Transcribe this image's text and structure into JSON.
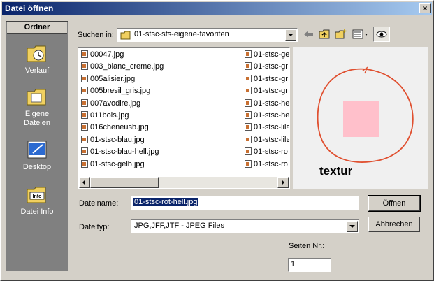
{
  "window": {
    "title": "Datei öffnen",
    "close_label": "×"
  },
  "sidebar": {
    "header": "Ordner",
    "items": [
      {
        "label": "Verlauf",
        "icon": "history-folder-icon"
      },
      {
        "label": "Eigene Dateien",
        "icon": "documents-folder-icon"
      },
      {
        "label": "Desktop",
        "icon": "desktop-icon"
      },
      {
        "label": "Datei Info",
        "icon": "file-info-icon"
      }
    ]
  },
  "lookin": {
    "label": "Suchen in:",
    "value": "01-stsc-sfs-eigene-favoriten"
  },
  "toolbar": {
    "icons": [
      "back-arrow-icon",
      "up-folder-icon",
      "new-folder-icon",
      "view-menu-icon",
      "preview-eye-icon"
    ]
  },
  "files": {
    "col1": [
      "00047.jpg",
      "003_blanc_creme.jpg",
      "005alisier.jpg",
      "005bresil_gris.jpg",
      "007avodire.jpg",
      "011bois.jpg",
      "016cheneusb.jpg",
      "01-stsc-blau.jpg",
      "01-stsc-blau-hell.jpg",
      "01-stsc-gelb.jpg"
    ],
    "col2": [
      "01-stsc-ge",
      "01-stsc-gr",
      "01-stsc-gr",
      "01-stsc-gr",
      "01-stsc-he",
      "01-stsc-he",
      "01-stsc-lila",
      "01-stsc-lila",
      "01-stsc-ro",
      "01-stsc-ro"
    ]
  },
  "preview": {
    "caption": "textur",
    "swatch_color": "#ffc0cb",
    "circle_color": "#e05030"
  },
  "filename": {
    "label": "Dateiname:",
    "value": "01-stsc-rot-hell.jpg"
  },
  "filetype": {
    "label": "Dateityp:",
    "value": "JPG,JFF,JTF - JPEG Files"
  },
  "pages": {
    "label": "Seiten Nr.:",
    "value": "1"
  },
  "buttons": {
    "open": "Öffnen",
    "cancel": "Abbrechen"
  }
}
